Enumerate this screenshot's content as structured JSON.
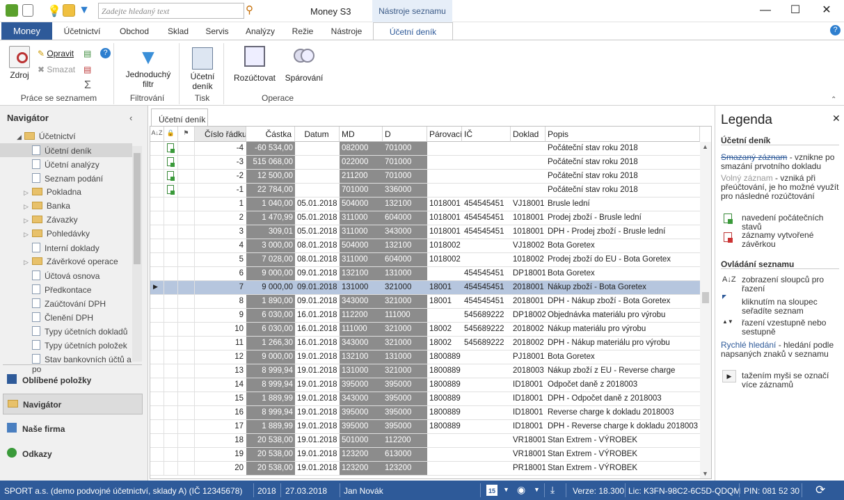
{
  "titlebar": {
    "search_placeholder": "Zadejte hledaný text",
    "app_title": "Money S3",
    "context_tab": "Nástroje seznamu"
  },
  "tabs": [
    "Money",
    "Účetnictví",
    "Obchod",
    "Sklad",
    "Servis",
    "Analýzy",
    "Režie",
    "Nástroje",
    "Účetní deník"
  ],
  "ribbon": {
    "zdroj": "Zdroj",
    "opravit": "Opravit",
    "smazat": "Smazat",
    "grp_prace": "Práce se seznamem",
    "filtr1": "Jednoduchý",
    "filtr2": "filtr",
    "grp_filtr": "Filtrování",
    "tisk1": "Účetní",
    "tisk2": "deník",
    "grp_tisk": "Tisk",
    "rozuctovat": "Rozúčtovat",
    "sparovani": "Spárování",
    "grp_operace": "Operace"
  },
  "nav": {
    "title": "Navigátor",
    "root": "Účetnictví",
    "items": [
      {
        "label": "Účetní deník",
        "type": "doc",
        "selected": true
      },
      {
        "label": "Účetní analýzy",
        "type": "doc"
      },
      {
        "label": "Seznam podání",
        "type": "doc"
      },
      {
        "label": "Pokladna",
        "type": "folder"
      },
      {
        "label": "Banka",
        "type": "folder"
      },
      {
        "label": "Závazky",
        "type": "folder"
      },
      {
        "label": "Pohledávky",
        "type": "folder"
      },
      {
        "label": "Interní doklady",
        "type": "doc"
      },
      {
        "label": "Závěrkové operace",
        "type": "folder"
      },
      {
        "label": "Účtová osnova",
        "type": "doc"
      },
      {
        "label": "Předkontace",
        "type": "doc"
      },
      {
        "label": "Zaúčtování DPH",
        "type": "doc"
      },
      {
        "label": "Členění DPH",
        "type": "doc"
      },
      {
        "label": "Typy účetních dokladů",
        "type": "doc"
      },
      {
        "label": "Typy účetních položek",
        "type": "doc"
      },
      {
        "label": "Stav bankovních účtů a po",
        "type": "doc"
      }
    ],
    "bottom": [
      "Oblíbené položky",
      "Navigátor",
      "Naše firma",
      "Odkazy"
    ]
  },
  "grid": {
    "tab": "Účetní deník",
    "headers": [
      "Číslo řádku",
      "Částka",
      "Datum",
      "MD",
      "D",
      "Párovací s",
      "IČ",
      "Doklad",
      "Popis"
    ],
    "rows": [
      [
        "-4",
        "-60 534,00",
        "",
        "082000",
        "701000",
        "",
        "",
        "",
        "Počáteční stav roku 2018"
      ],
      [
        "-3",
        "515 068,00",
        "",
        "022000",
        "701000",
        "",
        "",
        "",
        "Počáteční stav roku 2018"
      ],
      [
        "-2",
        "12 500,00",
        "",
        "211200",
        "701000",
        "",
        "",
        "",
        "Počáteční stav roku 2018"
      ],
      [
        "-1",
        "22 784,00",
        "",
        "701000",
        "336000",
        "",
        "",
        "",
        "Počáteční stav roku 2018"
      ],
      [
        "1",
        "1 040,00",
        "05.01.2018",
        "504000",
        "132100",
        "1018001",
        "454545451",
        "VJ18001",
        "Brusle lední"
      ],
      [
        "2",
        "1 470,99",
        "05.01.2018",
        "311000",
        "604000",
        "1018001",
        "454545451",
        "1018001",
        "Prodej zboží - Brusle lední"
      ],
      [
        "3",
        "309,01",
        "05.01.2018",
        "311000",
        "343000",
        "1018001",
        "454545451",
        "1018001",
        "DPH - Prodej zboží - Brusle lední"
      ],
      [
        "4",
        "3 000,00",
        "08.01.2018",
        "504000",
        "132100",
        "1018002",
        "",
        "VJ18002",
        "Bota Goretex"
      ],
      [
        "5",
        "7 028,00",
        "08.01.2018",
        "311000",
        "604000",
        "1018002",
        "",
        "1018002",
        "Prodej zboží do EU - Bota Goretex"
      ],
      [
        "6",
        "9 000,00",
        "09.01.2018",
        "132100",
        "131000",
        "",
        "454545451",
        "DP18001",
        "Bota Goretex"
      ],
      [
        "7",
        "9 000,00",
        "09.01.2018",
        "131000",
        "321000",
        "18001",
        "454545451",
        "2018001",
        "Nákup zboží - Bota Goretex"
      ],
      [
        "8",
        "1 890,00",
        "09.01.2018",
        "343000",
        "321000",
        "18001",
        "454545451",
        "2018001",
        "DPH - Nákup zboží - Bota Goretex"
      ],
      [
        "9",
        "6 030,00",
        "16.01.2018",
        "112200",
        "111000",
        "",
        "545689222",
        "DP18002",
        "Objednávka materiálu pro výrobu"
      ],
      [
        "10",
        "6 030,00",
        "16.01.2018",
        "111000",
        "321000",
        "18002",
        "545689222",
        "2018002",
        "Nákup materiálu pro výrobu"
      ],
      [
        "11",
        "1 266,30",
        "16.01.2018",
        "343000",
        "321000",
        "18002",
        "545689222",
        "2018002",
        "DPH - Nákup materiálu pro výrobu"
      ],
      [
        "12",
        "9 000,00",
        "19.01.2018",
        "132100",
        "131000",
        "1800889",
        "",
        "PJ18001",
        "Bota Goretex"
      ],
      [
        "13",
        "8 999,94",
        "19.01.2018",
        "131000",
        "321000",
        "1800889",
        "",
        "2018003",
        "Nákup zboží z EU - Reverse charge"
      ],
      [
        "14",
        "8 999,94",
        "19.01.2018",
        "395000",
        "395000",
        "1800889",
        "",
        "ID18001",
        "Odpočet daně z 2018003"
      ],
      [
        "15",
        "1 889,99",
        "19.01.2018",
        "343000",
        "395000",
        "1800889",
        "",
        "ID18001",
        "DPH - Odpočet daně z 2018003"
      ],
      [
        "16",
        "8 999,94",
        "19.01.2018",
        "395000",
        "395000",
        "1800889",
        "",
        "ID18001",
        "Reverse charge k dokladu 2018003"
      ],
      [
        "17",
        "1 889,99",
        "19.01.2018",
        "395000",
        "395000",
        "1800889",
        "",
        "ID18001",
        "DPH - Reverse charge k dokladu 2018003"
      ],
      [
        "18",
        "20 538,00",
        "19.01.2018",
        "501000",
        "112200",
        "",
        "",
        "VR18001",
        "Stan Extrem - VÝROBEK"
      ],
      [
        "19",
        "20 538,00",
        "19.01.2018",
        "123200",
        "613000",
        "",
        "",
        "VR18001",
        "Stan Extrem - VÝROBEK"
      ],
      [
        "20",
        "20 538,00",
        "19.01.2018",
        "123200",
        "123200",
        "",
        "",
        "PR18001",
        "Stan Extrem - VÝROBEK"
      ]
    ]
  },
  "legend": {
    "title": "Legenda",
    "sec1": "Účetní deník",
    "smazany": "Smazaný záznam",
    "smazany_desc": " - vznikne po smazání prvotního dokladu",
    "volny": "Volný záznam",
    "volny_desc": " - vzniká při přeúčtování, je ho možné využít pro následné rozúčtování",
    "pocatecni": "navedení počátečních stavů",
    "zaverka": "záznamy vytvořené závěrkou",
    "sec2": "Ovládání seznamu",
    "zobrazeni": "zobrazení sloupců pro řazení",
    "kliknutim": "kliknutím na sloupec seřadíte seznam",
    "razeni": "řazení vzestupně nebo sestupně",
    "rychle": "Rychlé hledání",
    "rychle_desc": " - hledání podle napsaných znaků v seznamu",
    "tazeni": "tažením myši se označí více záznamů"
  },
  "status": {
    "company": "SPORT a.s. (demo podvojné účetnictví, sklady A) (IČ 12345678)",
    "year": "2018",
    "date": "27.03.2018",
    "user": "Jan Novák",
    "version": "Verze: 18.300",
    "lic": "Lic: K3FN-98C2-6C5D-QDQM",
    "pin": "PIN: 081 52 30"
  },
  "colors": {
    "accent": "#2e5a99",
    "selected_row": "#b6c6de",
    "dark_column": "#8c8c8c"
  }
}
